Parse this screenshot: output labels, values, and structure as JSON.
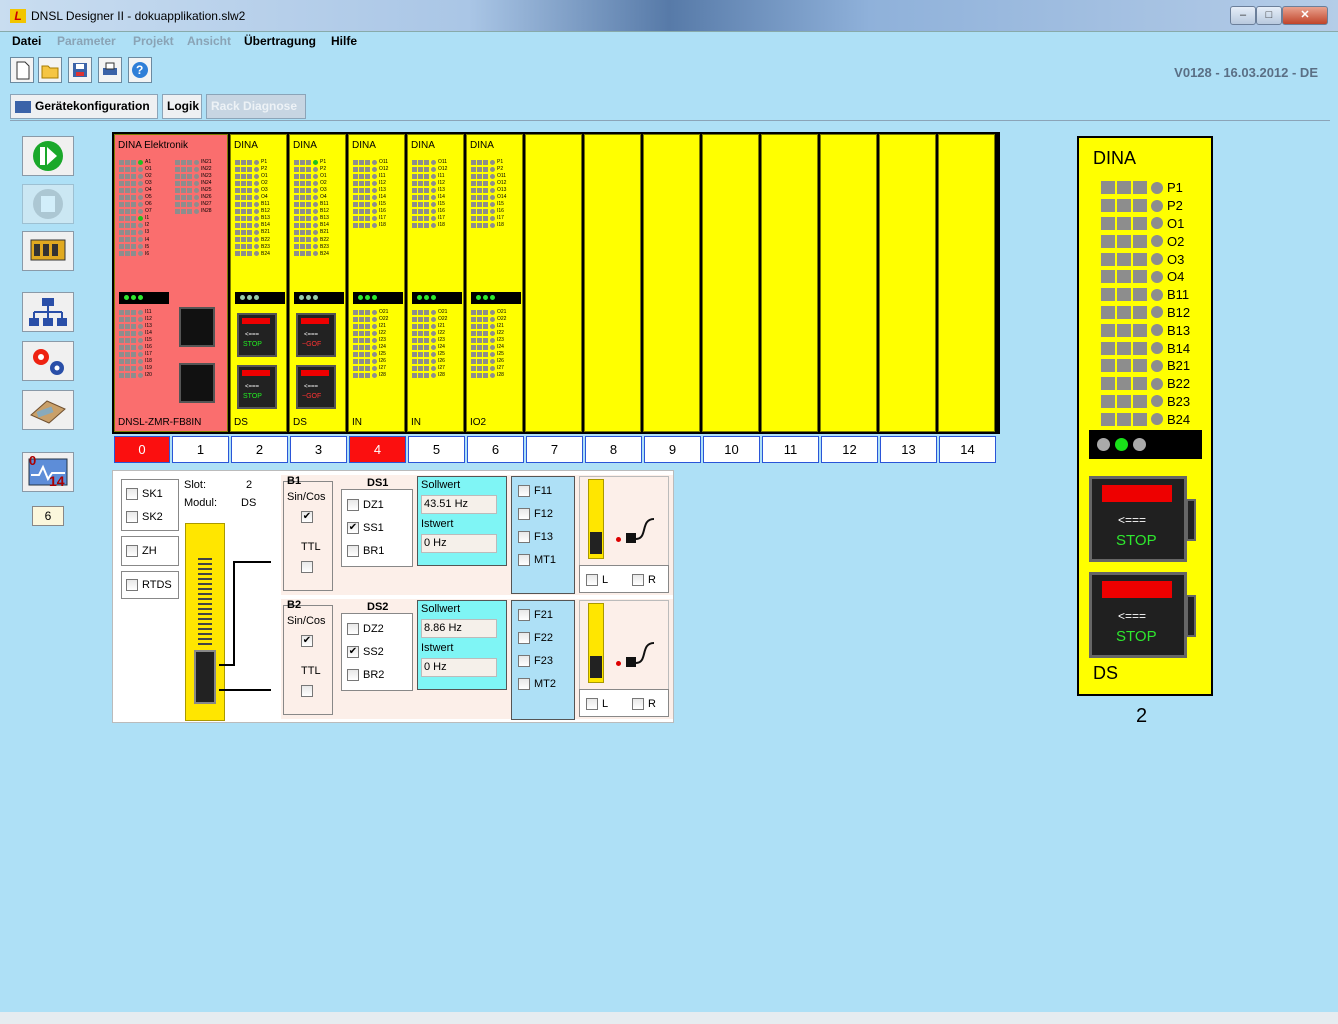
{
  "window": {
    "title": "DNSL Designer II - dokuapplikation.slw2",
    "logo": "L",
    "buttons": [
      "minimize",
      "maximize",
      "close"
    ]
  },
  "menu": [
    {
      "label": "Datei",
      "enabled": true
    },
    {
      "label": "Parameter",
      "enabled": false
    },
    {
      "label": "Projekt",
      "enabled": false
    },
    {
      "label": "Ansicht",
      "enabled": false
    },
    {
      "label": "Übertragung",
      "enabled": true
    },
    {
      "label": "Hilfe",
      "enabled": true
    }
  ],
  "toolbar": {
    "icons": [
      "new-file-icon",
      "open-folder-icon",
      "save-icon",
      "print-icon",
      "help-icon"
    ]
  },
  "version": "V0128  - 16.03.2012 -  DE",
  "tabs": [
    {
      "label": "Gerätekonfiguration",
      "enabled": true
    },
    {
      "label": "Logik",
      "enabled": true
    },
    {
      "label": "Rack Diagnose",
      "enabled": false
    }
  ],
  "sidebar": {
    "buttons": [
      "start-icon",
      "stop-icon",
      "module-icon",
      "network-icon",
      "settings-icon",
      "transfer-icon",
      "diagnose-icon"
    ],
    "diag_top": "0",
    "diag_bottom": "14",
    "counter": "6"
  },
  "rack": {
    "slots": [
      {
        "num": "0",
        "title": "DINA Elektronik",
        "name": "DNSL-ZMR-FB8IN",
        "type": "master",
        "selected": true
      },
      {
        "num": "1",
        "title": "",
        "name": "",
        "type": "master-ext",
        "selected": false
      },
      {
        "num": "2",
        "title": "DINA",
        "name": "DS",
        "type": "ds",
        "selected": false,
        "stop1": "STOP",
        "stop2": "STOP"
      },
      {
        "num": "3",
        "title": "DINA",
        "name": "DS",
        "type": "ds",
        "selected": false,
        "stop1": "~GOF",
        "stop2": "~GOF"
      },
      {
        "num": "4",
        "title": "DINA",
        "name": "IN",
        "type": "in",
        "selected": true
      },
      {
        "num": "5",
        "title": "DINA",
        "name": "IN",
        "type": "in",
        "selected": false
      },
      {
        "num": "6",
        "title": "DINA",
        "name": "IO2",
        "type": "io2",
        "selected": false
      },
      {
        "num": "7",
        "title": "",
        "name": "",
        "type": "empty"
      },
      {
        "num": "8",
        "title": "",
        "name": "",
        "type": "empty"
      },
      {
        "num": "9",
        "title": "",
        "name": "",
        "type": "empty"
      },
      {
        "num": "10",
        "title": "",
        "name": "",
        "type": "empty"
      },
      {
        "num": "11",
        "title": "",
        "name": "",
        "type": "empty"
      },
      {
        "num": "12",
        "title": "",
        "name": "",
        "type": "empty"
      },
      {
        "num": "13",
        "title": "",
        "name": "",
        "type": "empty"
      },
      {
        "num": "14",
        "title": "",
        "name": "",
        "type": "empty"
      }
    ],
    "labels": {
      "master_a": [
        "A1",
        "O1",
        "O2",
        "O3",
        "O4",
        "O5",
        "O6",
        "O7",
        "I1",
        "I2",
        "I3",
        "I4",
        "I5",
        "I6"
      ],
      "master_b": [
        "IN21",
        "IN22",
        "IN23",
        "IN24",
        "IN25",
        "IN26",
        "IN27",
        "IN28"
      ],
      "master_c": [
        "I11",
        "I12",
        "I13",
        "I14",
        "I15",
        "I16",
        "I17",
        "I18",
        "I19",
        "I20"
      ],
      "ds": [
        "P1",
        "P2",
        "O1",
        "O2",
        "O3",
        "O4",
        "B11",
        "B12",
        "B13",
        "B14",
        "B21",
        "B22",
        "B23",
        "B24"
      ],
      "in_top": [
        "O11",
        "O12",
        "I11",
        "I12",
        "I13",
        "I14",
        "I15",
        "I16",
        "I17",
        "I18"
      ],
      "in_bot": [
        "O21",
        "O22",
        "I21",
        "I22",
        "I23",
        "I24",
        "I25",
        "I26",
        "I27",
        "I28"
      ],
      "io2_top": [
        "P1",
        "P2",
        "O11",
        "O12",
        "O13",
        "O14",
        "I15",
        "I16",
        "I17",
        "I18"
      ]
    }
  },
  "big_module": {
    "title": "DINA",
    "name": "DS",
    "slot_num": "2",
    "leds": [
      "P1",
      "P2",
      "O1",
      "O2",
      "O3",
      "O4",
      "B11",
      "B12",
      "B13",
      "B14",
      "B21",
      "B22",
      "B23",
      "B24"
    ],
    "arrow": "<===",
    "stop": "STOP"
  },
  "detail": {
    "sk": [
      {
        "label": "SK1",
        "checked": false
      },
      {
        "label": "SK2",
        "checked": false
      }
    ],
    "zh": {
      "label": "ZH",
      "checked": false
    },
    "rtds": {
      "label": "RTDS",
      "checked": false
    },
    "slot_label": "Slot:",
    "slot_value": "2",
    "modul_label": "Modul:",
    "modul_value": "DS",
    "channels": [
      {
        "group": "B1",
        "sincos": "Sin/Cos",
        "sincos_checked": true,
        "ttl": "TTL",
        "ttl_checked": false,
        "ds": "DS1",
        "dz": "DZ1",
        "dz_checked": false,
        "ss": "SS1",
        "ss_checked": true,
        "br": "BR1",
        "br_checked": false,
        "soll_label": "Sollwert",
        "soll_value": "43.51 Hz",
        "ist_label": "Istwert",
        "ist_value": "0 Hz",
        "f": [
          {
            "label": "F11",
            "checked": false
          },
          {
            "label": "F12",
            "checked": false
          },
          {
            "label": "F13",
            "checked": false
          },
          {
            "label": "MT1",
            "checked": false
          }
        ],
        "l": "L",
        "r": "R"
      },
      {
        "group": "B2",
        "sincos": "Sin/Cos",
        "sincos_checked": true,
        "ttl": "TTL",
        "ttl_checked": false,
        "ds": "DS2",
        "dz": "DZ2",
        "dz_checked": false,
        "ss": "SS2",
        "ss_checked": true,
        "br": "BR2",
        "br_checked": false,
        "soll_label": "Sollwert",
        "soll_value": "8.86 Hz",
        "ist_label": "Istwert",
        "ist_value": "0 Hz",
        "f": [
          {
            "label": "F21",
            "checked": false
          },
          {
            "label": "F22",
            "checked": false
          },
          {
            "label": "F23",
            "checked": false
          },
          {
            "label": "MT2",
            "checked": false
          }
        ],
        "l": "L",
        "r": "R"
      }
    ]
  }
}
